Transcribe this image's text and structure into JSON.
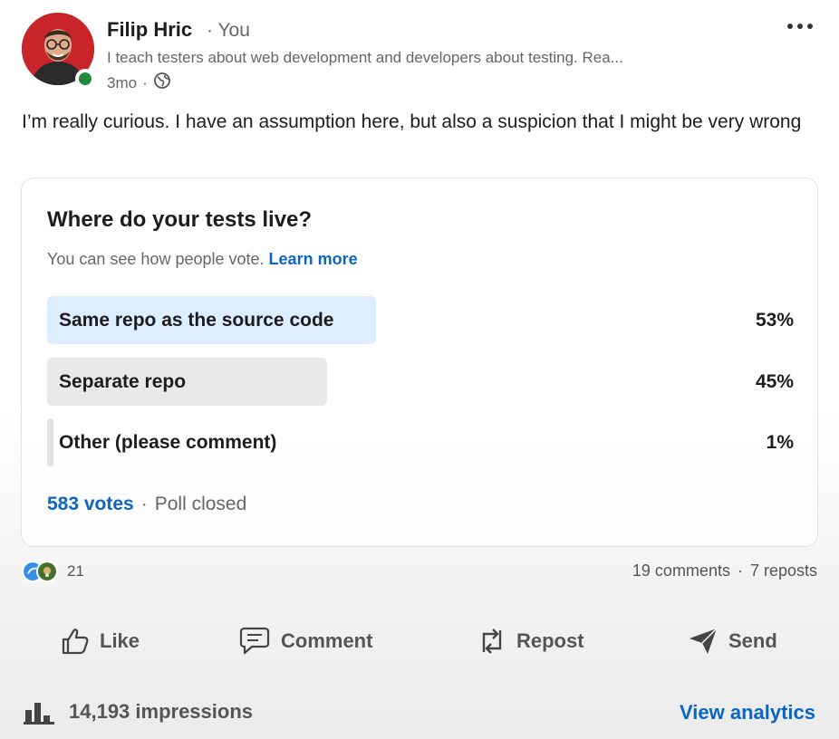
{
  "author": {
    "name": "Filip Hric",
    "relation": "You",
    "headline": "I teach testers about web development and developers about testing. Rea...",
    "time": "3mo",
    "visibility_icon": "globe-icon",
    "online_color": "#1f8a3b"
  },
  "post": {
    "text": "I’m really curious. I have an assumption here, but also a suspicion that I might be very wrong"
  },
  "poll": {
    "question": "Where do your tests live?",
    "note": "You can see how people vote.",
    "learn_more": "Learn more",
    "options": [
      {
        "label": "Same repo as the source code",
        "percent": "53%",
        "fill": 0.44,
        "color": "#dceeff"
      },
      {
        "label": "Separate repo",
        "percent": "45%",
        "fill": 0.375,
        "color": "#e9e9e9"
      },
      {
        "label": "Other (please comment)",
        "percent": "1%",
        "fill": 0.008,
        "color": "#e2e2e2"
      }
    ],
    "votes": "583 votes",
    "status": "Poll closed"
  },
  "social": {
    "reaction_count": "21",
    "comments": "19 comments",
    "reposts": "7 reposts"
  },
  "actions": {
    "like": "Like",
    "comment": "Comment",
    "repost": "Repost",
    "send": "Send"
  },
  "impressions": {
    "count": "14,193 impressions",
    "analytics": "View analytics"
  },
  "colors": {
    "accent": "#0a66c2",
    "avatar_bg": "#c8242a"
  }
}
